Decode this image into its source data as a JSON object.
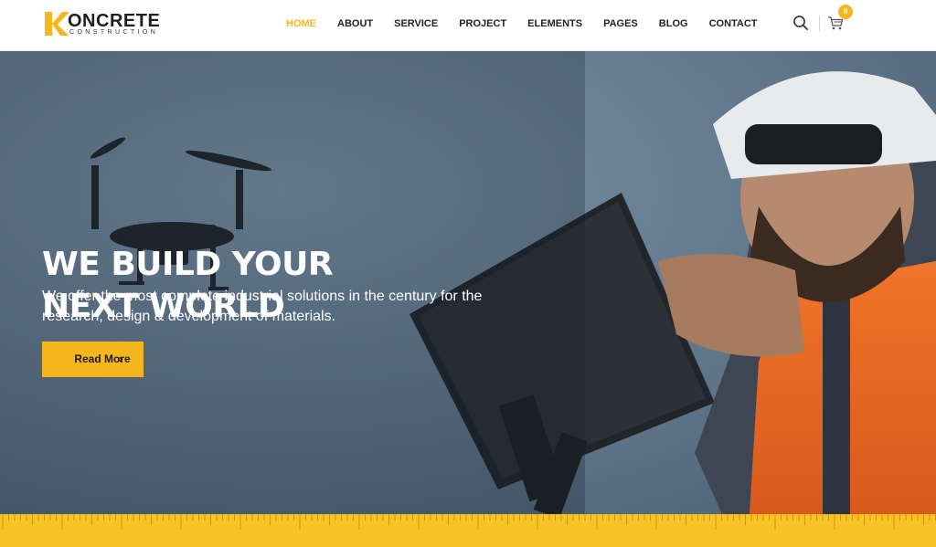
{
  "brand": {
    "name": "ONCRETE",
    "tagline": "CONSTRUCTION",
    "accent_color": "#f6b71e"
  },
  "nav": {
    "items": [
      {
        "label": "HOME",
        "active": true
      },
      {
        "label": "ABOUT",
        "active": false
      },
      {
        "label": "SERVICE",
        "active": false
      },
      {
        "label": "PROJECT",
        "active": false
      },
      {
        "label": "ELEMENTS",
        "active": false
      },
      {
        "label": "PAGES",
        "active": false
      },
      {
        "label": "BLOG",
        "active": false
      },
      {
        "label": "CONTACT",
        "active": false
      }
    ]
  },
  "header_icons": {
    "search": "search-icon",
    "cart": "cart-icon",
    "cart_count": "0"
  },
  "hero": {
    "title_line1": "WE BUILD YOUR",
    "title_line2": "NEXT WORLD",
    "text": "We offer the most complete industrial solutions in the century for the research, design & development of materials.",
    "button_label": "Read More",
    "button_icon": "chevron-right-icon"
  },
  "ruler": {
    "color": "#f7c326"
  }
}
